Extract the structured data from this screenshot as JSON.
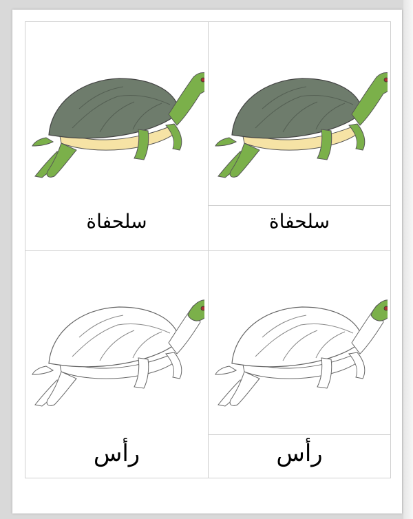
{
  "cards": [
    {
      "position": "top-left",
      "picture": "turtle-full-color",
      "label": "سلحفاة"
    },
    {
      "position": "top-right",
      "picture": "turtle-full-color",
      "label": "سلحفاة"
    },
    {
      "position": "bottom-left",
      "picture": "turtle-outline-head-highlighted",
      "label": "رأس"
    },
    {
      "position": "bottom-right",
      "picture": "turtle-outline-head-highlighted",
      "label": "رأس"
    }
  ],
  "colors": {
    "shell": "#6e7c6c",
    "skin": "#7bb04a",
    "plastron": "#f6e3a5",
    "outline": "#555555",
    "grid_border": "#cfcfcf"
  }
}
